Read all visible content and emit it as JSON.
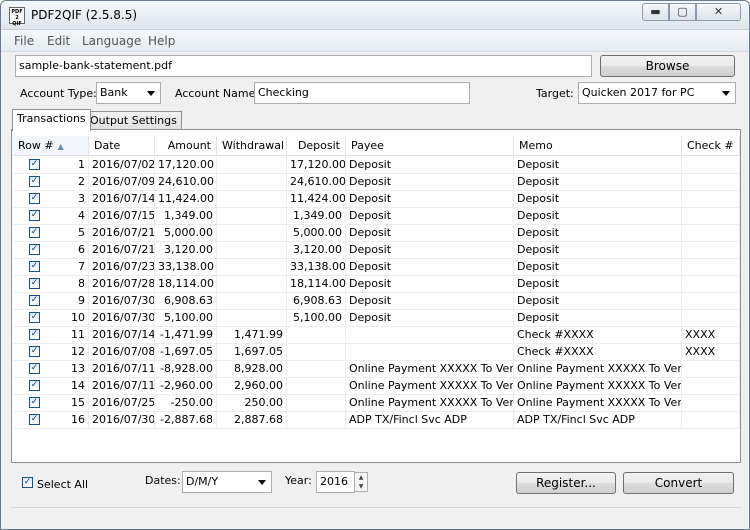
{
  "window": {
    "title": "PDF2QIF (2.5.8.5)",
    "min_glyph": "▬",
    "max_glyph": "▢",
    "close_glyph": "✕",
    "icon_text": "PDF\n2\nQIF"
  },
  "menu": [
    "File",
    "Edit",
    "Language",
    "Help"
  ],
  "file_path": "sample-bank-statement.pdf",
  "browse_label": "Browse",
  "account_type": {
    "label": "Account Type:",
    "value": "Bank"
  },
  "account_name": {
    "label": "Account Name:",
    "value": "Checking"
  },
  "target": {
    "label": "Target:",
    "value": "Quicken 2017 for PC"
  },
  "tabs": [
    "Transactions",
    "Output Settings"
  ],
  "columns": [
    "Row #",
    "Date",
    "Amount",
    "Withdrawal",
    "Deposit",
    "Payee",
    "Memo",
    "Check #"
  ],
  "rows": [
    {
      "row": "1",
      "date": "2016/07/02",
      "amount": "17,120.00",
      "withdrawal": "",
      "deposit": "17,120.00",
      "payee": "Deposit",
      "memo": "Deposit",
      "check": ""
    },
    {
      "row": "2",
      "date": "2016/07/09",
      "amount": "24,610.00",
      "withdrawal": "",
      "deposit": "24,610.00",
      "payee": "Deposit",
      "memo": "Deposit",
      "check": ""
    },
    {
      "row": "3",
      "date": "2016/07/14",
      "amount": "11,424.00",
      "withdrawal": "",
      "deposit": "11,424.00",
      "payee": "Deposit",
      "memo": "Deposit",
      "check": ""
    },
    {
      "row": "4",
      "date": "2016/07/15",
      "amount": "1,349.00",
      "withdrawal": "",
      "deposit": "1,349.00",
      "payee": "Deposit",
      "memo": "Deposit",
      "check": ""
    },
    {
      "row": "5",
      "date": "2016/07/21",
      "amount": "5,000.00",
      "withdrawal": "",
      "deposit": "5,000.00",
      "payee": "Deposit",
      "memo": "Deposit",
      "check": ""
    },
    {
      "row": "6",
      "date": "2016/07/21",
      "amount": "3,120.00",
      "withdrawal": "",
      "deposit": "3,120.00",
      "payee": "Deposit",
      "memo": "Deposit",
      "check": ""
    },
    {
      "row": "7",
      "date": "2016/07/23",
      "amount": "33,138.00",
      "withdrawal": "",
      "deposit": "33,138.00",
      "payee": "Deposit",
      "memo": "Deposit",
      "check": ""
    },
    {
      "row": "8",
      "date": "2016/07/28",
      "amount": "18,114.00",
      "withdrawal": "",
      "deposit": "18,114.00",
      "payee": "Deposit",
      "memo": "Deposit",
      "check": ""
    },
    {
      "row": "9",
      "date": "2016/07/30",
      "amount": "6,908.63",
      "withdrawal": "",
      "deposit": "6,908.63",
      "payee": "Deposit",
      "memo": "Deposit",
      "check": ""
    },
    {
      "row": "10",
      "date": "2016/07/30",
      "amount": "5,100.00",
      "withdrawal": "",
      "deposit": "5,100.00",
      "payee": "Deposit",
      "memo": "Deposit",
      "check": ""
    },
    {
      "row": "11",
      "date": "2016/07/14",
      "amount": "-1,471.99",
      "withdrawal": "1,471.99",
      "deposit": "",
      "payee": "",
      "memo": "Check #XXXX",
      "check": "XXXX"
    },
    {
      "row": "12",
      "date": "2016/07/08",
      "amount": "-1,697.05",
      "withdrawal": "1,697.05",
      "deposit": "",
      "payee": "",
      "memo": "Check #XXXX",
      "check": "XXXX"
    },
    {
      "row": "13",
      "date": "2016/07/11",
      "amount": "-8,928.00",
      "withdrawal": "8,928.00",
      "deposit": "",
      "payee": "Online Payment XXXXX To Vendor",
      "memo": "Online Payment XXXXX To Vendor",
      "check": ""
    },
    {
      "row": "14",
      "date": "2016/07/11",
      "amount": "-2,960.00",
      "withdrawal": "2,960.00",
      "deposit": "",
      "payee": "Online Payment XXXXX To Vendor",
      "memo": "Online Payment XXXXX To Vendor",
      "check": ""
    },
    {
      "row": "15",
      "date": "2016/07/25",
      "amount": "-250.00",
      "withdrawal": "250.00",
      "deposit": "",
      "payee": "Online Payment XXXXX To Vendor",
      "memo": "Online Payment XXXXX To Vendor",
      "check": ""
    },
    {
      "row": "16",
      "date": "2016/07/30",
      "amount": "-2,887.68",
      "withdrawal": "2,887.68",
      "deposit": "",
      "payee": "ADP TX/Fincl Svc ADP",
      "memo": "ADP TX/Fincl Svc ADP",
      "check": ""
    }
  ],
  "select_all_label": "Select All",
  "dates": {
    "label": "Dates:",
    "value": "D/M/Y"
  },
  "year": {
    "label": "Year:",
    "value": "2016"
  },
  "register_label": "Register...",
  "convert_label": "Convert",
  "colors": {
    "check_border": "#1c5180",
    "sort_arrow": "#6a8fb5"
  }
}
